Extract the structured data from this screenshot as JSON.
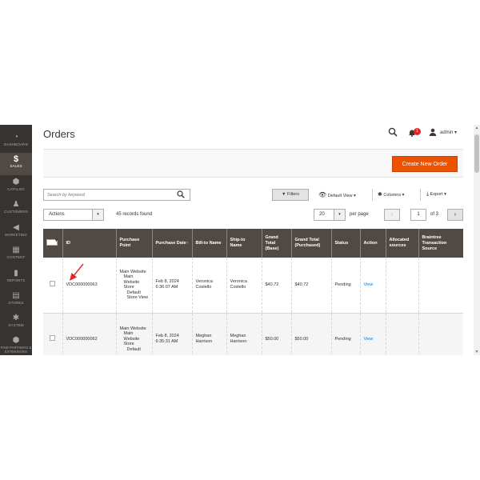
{
  "sidebar": {
    "items": [
      {
        "label": "DASHBOARD",
        "icon": "dashboard-icon",
        "glyph": "◔"
      },
      {
        "label": "SALES",
        "icon": "dollar-icon",
        "glyph": "$"
      },
      {
        "label": "CATALOG",
        "icon": "cube-icon",
        "glyph": "⬢"
      },
      {
        "label": "CUSTOMERS",
        "icon": "person-icon",
        "glyph": "♟"
      },
      {
        "label": "MARKETING",
        "icon": "megaphone-icon",
        "glyph": "◀"
      },
      {
        "label": "CONTENT",
        "icon": "content-icon",
        "glyph": "▦"
      },
      {
        "label": "REPORTS",
        "icon": "bar-chart-icon",
        "glyph": "▮"
      },
      {
        "label": "STORES",
        "icon": "store-icon",
        "glyph": "▤"
      },
      {
        "label": "SYSTEM",
        "icon": "gear-icon",
        "glyph": "✱"
      },
      {
        "label": "FIND PARTNERS & EXTENSIONS",
        "icon": "extensions-icon",
        "glyph": "⬢"
      }
    ]
  },
  "header": {
    "title": "Orders",
    "notifications_count": "1",
    "user": "admin",
    "user_caret": "▾"
  },
  "action_bar": {
    "create_label": "Create New Order"
  },
  "toolbar": {
    "search_placeholder": "Search by keyword",
    "filters_label": "Filters",
    "view_label": "Default View",
    "columns_label": "Columns",
    "export_label": "Export",
    "actions_label": "Actions",
    "records_label": "45 records found",
    "per_page_value": "20",
    "per_page_label": "per page",
    "page_value": "1",
    "page_of": "of 3",
    "prev_glyph": "‹",
    "next_glyph": "›",
    "caret": "▾"
  },
  "table": {
    "columns": [
      "ID",
      "Purchase Point",
      "Purchase Date",
      "Bill-to Name",
      "Ship-to Name",
      "Grand Total (Base)",
      "Grand Total (Purchased)",
      "Status",
      "Action",
      "Allocated sources",
      "Braintree Transaction Source"
    ],
    "rows": [
      {
        "id": "VDC000000063",
        "purchase_point": [
          "Main Website",
          "Main Website Store",
          "Default Store View"
        ],
        "date": "Feb 8, 2024 6:36:07 AM",
        "bill_to": "Veronica Costello",
        "ship_to": "Veronica Costello",
        "total_base": "$40.72",
        "total_purchased": "$40.72",
        "status": "Pending",
        "action": "View",
        "allocated": "",
        "braintree": ""
      },
      {
        "id": "VDC000000062",
        "purchase_point": [
          "Main Website",
          "Main Website Store",
          "Default"
        ],
        "date": "Feb 8, 2024 6:35:31 AM",
        "bill_to": "Meghan Harrison",
        "ship_to": "Meghan Harrison",
        "total_base": "$50.00",
        "total_purchased": "$50.00",
        "status": "Pending",
        "action": "View",
        "allocated": "",
        "braintree": ""
      }
    ],
    "sort_indicator": "↑"
  },
  "colors": {
    "accent": "#eb5202",
    "sidebar_bg": "#373330",
    "header_bg": "#514943",
    "link": "#007bdb",
    "arrow": "#e22626"
  }
}
